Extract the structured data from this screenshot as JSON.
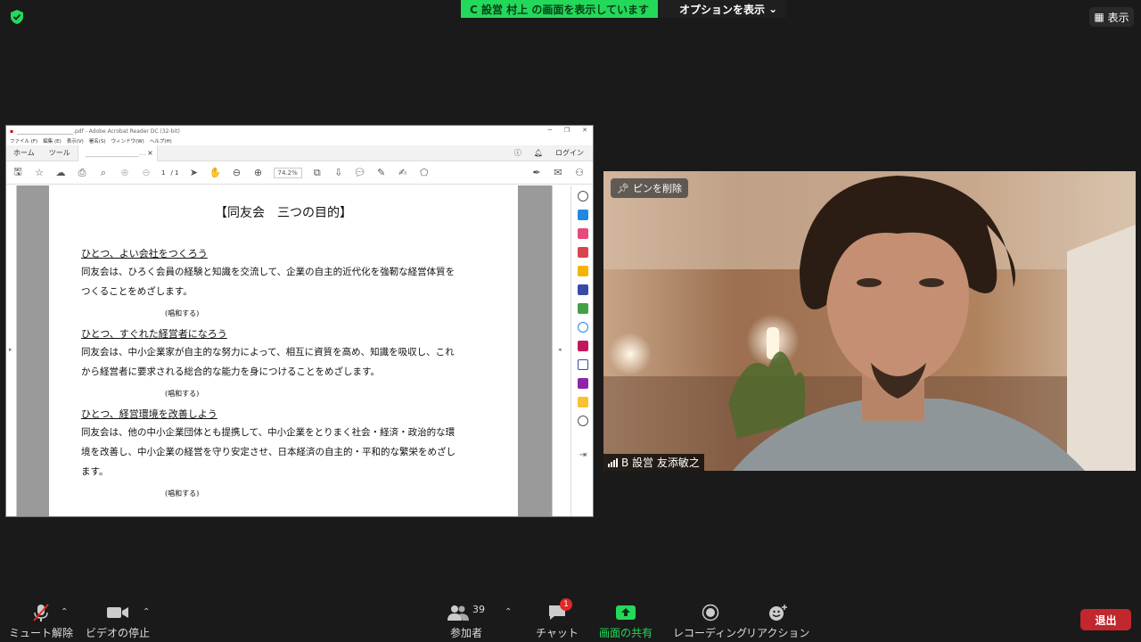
{
  "top": {
    "share_banner": "C 設営 村上 の画面を表示しています",
    "options_label": "オプションを表示",
    "view_label": "表示"
  },
  "pdf": {
    "window_title": "_____________________.pdf - Adobe Acrobat Reader DC (32-bit)",
    "menu": [
      "ファイル (F)",
      "編集 (E)",
      "表示(V)",
      "署名(S)",
      "ウィンドウ(W)",
      "ヘルプ(H)"
    ],
    "tabs": {
      "home": "ホーム",
      "tools": "ツール",
      "doc": "_______________..."
    },
    "login": "ログイン",
    "page_current": "1",
    "page_total": "/ 1",
    "zoom": "74.2%",
    "doc": {
      "title": "【同友会　三つの目的】",
      "sections": [
        {
          "heading": "ひとつ、よい会社をつくろう",
          "line1": "同友会は、ひろく会員の経験と知識を交流して、企業の自主的近代化を強靭な経営体質を",
          "line2": "つくることをめざします。",
          "note": "(唱和する)"
        },
        {
          "heading": "ひとつ、すぐれた経営者になろう",
          "line1": "同友会は、中小企業家が自主的な努力によって、相互に資質を高め、知識を吸収し、これ",
          "line2": "から経営者に要求される総合的な能力を身につけることをめざします。",
          "note": "(唱和する)"
        },
        {
          "heading": "ひとつ、経営環境を改善しよう",
          "line1": "同友会は、他の中小企業団体とも提携して、中小企業をとりまく社会・経済・政治的な環",
          "line2": "境を改善し、中小企業の経営を守り安定させ、日本経済の自主的・平和的な繁栄をめざし",
          "line3": "ます。",
          "note": "(唱和する)"
        }
      ]
    }
  },
  "video": {
    "pin_label": "ピンを削除",
    "participant_name": "B 設営 友添敏之"
  },
  "bottom": {
    "mute": "ミュート解除",
    "video": "ビデオの停止",
    "participants": "参加者",
    "participants_count": "39",
    "chat": "チャット",
    "chat_badge": "1",
    "share": "画面の共有",
    "record": "レコーディング",
    "reaction": "リアクション",
    "leave": "退出"
  },
  "colors": {
    "share_green": "#23d959",
    "leave_red": "#c1272d"
  }
}
